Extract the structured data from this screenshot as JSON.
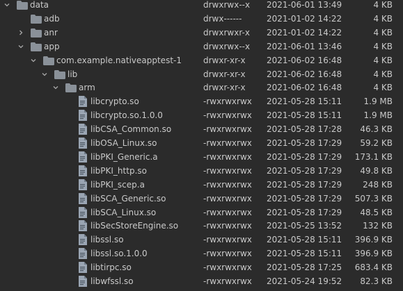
{
  "rows": [
    {
      "name": "data",
      "perm": "drwxrwx--x",
      "date": "2021-06-01 13:49",
      "size": "4 KB",
      "type": "folder",
      "state": "expanded"
    },
    {
      "name": "adb",
      "perm": "drwx------",
      "date": "2021-01-02 14:22",
      "size": "4 KB",
      "type": "folder",
      "state": "none"
    },
    {
      "name": "anr",
      "perm": "drwxrwxr-x",
      "date": "2021-01-02 14:22",
      "size": "4 KB",
      "type": "folder",
      "state": "collapsed"
    },
    {
      "name": "app",
      "perm": "drwxrwx--x",
      "date": "2021-06-01 13:46",
      "size": "4 KB",
      "type": "folder",
      "state": "expanded"
    },
    {
      "name": "com.example.nativeapptest-1",
      "perm": "drwxr-xr-x",
      "date": "2021-06-02 16:48",
      "size": "4 KB",
      "type": "folder",
      "state": "expanded"
    },
    {
      "name": "lib",
      "perm": "drwxr-xr-x",
      "date": "2021-06-02 16:48",
      "size": "4 KB",
      "type": "folder",
      "state": "expanded"
    },
    {
      "name": "arm",
      "perm": "drwxr-xr-x",
      "date": "2021-06-02 16:48",
      "size": "4 KB",
      "type": "folder",
      "state": "expanded"
    },
    {
      "name": "libcrypto.so",
      "perm": "-rwxrwxrwx",
      "date": "2021-05-28 15:11",
      "size": "1.9 MB",
      "type": "file"
    },
    {
      "name": "libcrypto.so.1.0.0",
      "perm": "-rwxrwxrwx",
      "date": "2021-05-28 15:11",
      "size": "1.9 MB",
      "type": "file"
    },
    {
      "name": "libCSA_Common.so",
      "perm": "-rwxrwxrwx",
      "date": "2021-05-28 17:28",
      "size": "46.3 KB",
      "type": "file"
    },
    {
      "name": "libOSA_Linux.so",
      "perm": "-rwxrwxrwx",
      "date": "2021-05-28 17:29",
      "size": "59.2 KB",
      "type": "file"
    },
    {
      "name": "libPKI_Generic.a",
      "perm": "-rwxrwxrwx",
      "date": "2021-05-28 17:29",
      "size": "173.1 KB",
      "type": "file"
    },
    {
      "name": "libPKI_http.so",
      "perm": "-rwxrwxrwx",
      "date": "2021-05-28 17:29",
      "size": "49.8 KB",
      "type": "file"
    },
    {
      "name": "libPKI_scep.a",
      "perm": "-rwxrwxrwx",
      "date": "2021-05-28 17:29",
      "size": "248 KB",
      "type": "file"
    },
    {
      "name": "libSCA_Generic.so",
      "perm": "-rwxrwxrwx",
      "date": "2021-05-28 17:29",
      "size": "507.3 KB",
      "type": "file"
    },
    {
      "name": "libSCA_Linux.so",
      "perm": "-rwxrwxrwx",
      "date": "2021-05-28 17:29",
      "size": "48.5 KB",
      "type": "file"
    },
    {
      "name": "libSecStoreEngine.so",
      "perm": "-rwxrwxrwx",
      "date": "2021-05-25 13:52",
      "size": "132 KB",
      "type": "file"
    },
    {
      "name": "libssl.so",
      "perm": "-rwxrwxrwx",
      "date": "2021-05-28 15:11",
      "size": "396.9 KB",
      "type": "file"
    },
    {
      "name": "libssl.so.1.0.0",
      "perm": "-rwxrwxrwx",
      "date": "2021-05-28 15:11",
      "size": "396.9 KB",
      "type": "file"
    },
    {
      "name": "libtirpc.so",
      "perm": "-rwxrwxrwx",
      "date": "2021-05-28 17:25",
      "size": "683.4 KB",
      "type": "file"
    },
    {
      "name": "libwfssl.so",
      "perm": "-rwxrwxrwx",
      "date": "2021-05-24 19:52",
      "size": "82.3 KB",
      "type": "file"
    }
  ],
  "colors": {
    "background": "#2b2b2b",
    "text": "#c9c9c9",
    "folder": "#8a9199",
    "file": "#9aa5b3",
    "arrow": "#a8a8a8"
  },
  "icons": {
    "folder": "folder-icon",
    "file": "file-icon",
    "expanded": "chevron-down-icon",
    "collapsed": "chevron-right-icon"
  }
}
